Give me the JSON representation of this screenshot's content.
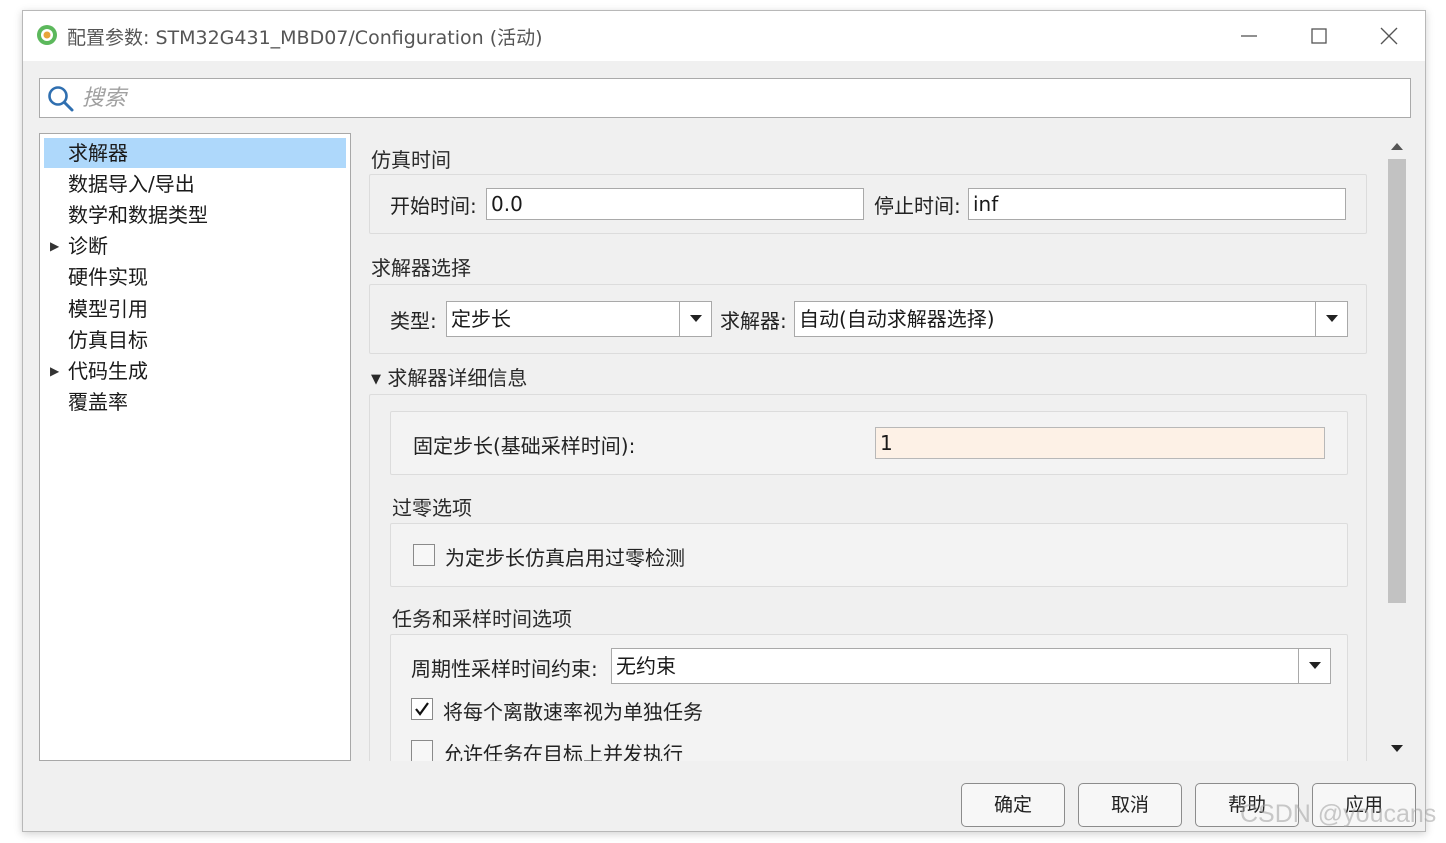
{
  "window": {
    "title": "配置参数: STM32G431_MBD07/Configuration (活动)"
  },
  "search": {
    "placeholder": "搜索"
  },
  "tree": {
    "items": [
      {
        "label": "求解器",
        "selected": true,
        "expandable": false
      },
      {
        "label": "数据导入/导出",
        "selected": false,
        "expandable": false
      },
      {
        "label": "数学和数据类型",
        "selected": false,
        "expandable": false
      },
      {
        "label": "诊断",
        "selected": false,
        "expandable": true
      },
      {
        "label": "硬件实现",
        "selected": false,
        "expandable": false
      },
      {
        "label": "模型引用",
        "selected": false,
        "expandable": false
      },
      {
        "label": "仿真目标",
        "selected": false,
        "expandable": false
      },
      {
        "label": "代码生成",
        "selected": false,
        "expandable": true
      },
      {
        "label": "覆盖率",
        "selected": false,
        "expandable": false
      }
    ]
  },
  "sim_time": {
    "title": "仿真时间",
    "start_label": "开始时间:",
    "start_value": "0.0",
    "stop_label": "停止时间:",
    "stop_value": "inf"
  },
  "solver_select": {
    "title": "求解器选择",
    "type_label": "类型:",
    "type_value": "定步长",
    "solver_label": "求解器:",
    "solver_value": "自动(自动求解器选择)"
  },
  "solver_details": {
    "title": "求解器详细信息",
    "fixed_step_label": "固定步长(基础采样时间):",
    "fixed_step_value": "1"
  },
  "zero_crossing": {
    "title": "过零选项",
    "enable_label": "为定步长仿真启用过零检测",
    "enable_checked": false
  },
  "tasks": {
    "title": "任务和采样时间选项",
    "periodic_label": "周期性采样时间约束:",
    "periodic_value": "无约束",
    "each_rate_label": "将每个离散速率视为单独任务",
    "each_rate_checked": true,
    "concurrent_label": "允许任务在目标上并发执行",
    "concurrent_checked": false
  },
  "buttons": {
    "ok": "确定",
    "cancel": "取消",
    "help": "帮助",
    "apply": "应用"
  },
  "watermark": "CSDN @youcans",
  "colors": {
    "selection": "#aed8fb",
    "fixed_step_bg": "#fdf1e6",
    "dialog_bg": "#f0f0f0"
  }
}
